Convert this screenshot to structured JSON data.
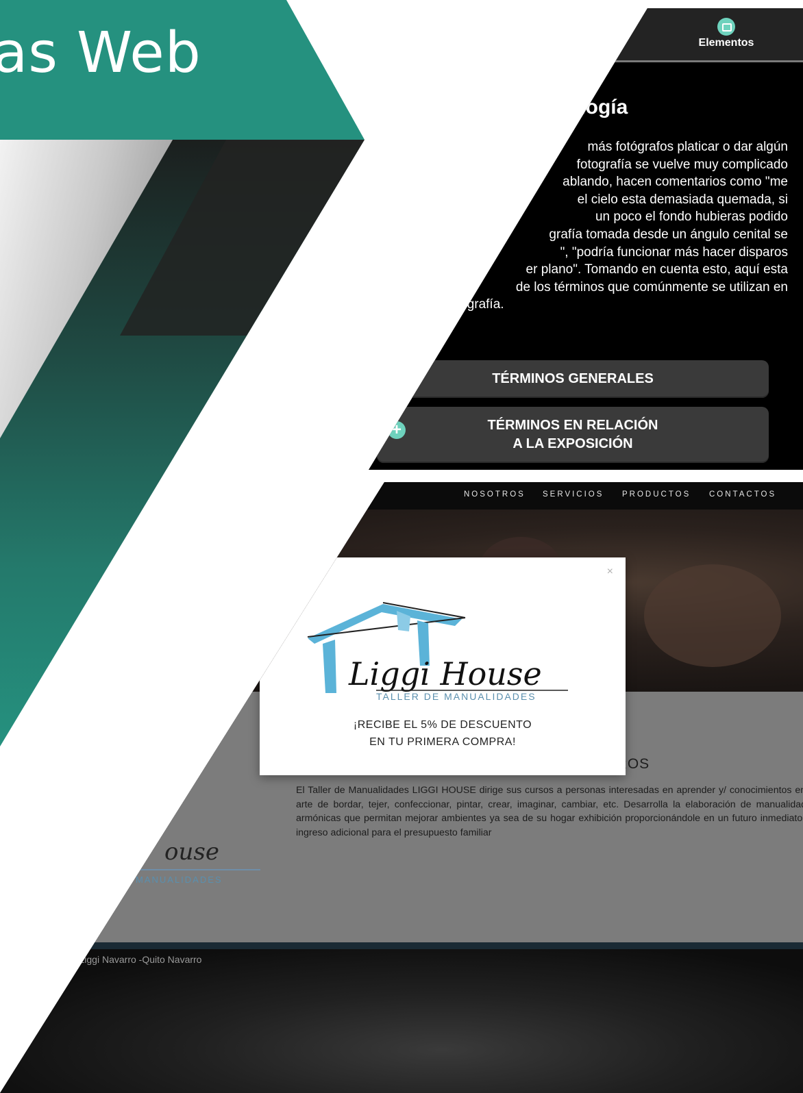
{
  "slide": {
    "title_fragment": "as Web",
    "colors": {
      "teal": "#25917f",
      "dark": "#1e1e1e",
      "white": "#ffffff"
    }
  },
  "photo_app": {
    "tab_label": "Elementos",
    "tab_icon": "camera-icon",
    "section_title_fragment": "ología",
    "body_lines": [
      "más fotógrafos platicar o dar algún",
      "fotografía se vuelve muy complicado",
      "ablando, hacen comentarios como \"me",
      "el cielo esta demasiada quemada, si",
      "un poco el fondo hubieras podido",
      "grafía tomada desde un ángulo cenital se",
      "\", \"podría funcionar más hacer disparos",
      "er plano\". Tomando en cuenta esto, aquí esta",
      "de los términos que comúnmente se utilizan en",
      "fotografía."
    ],
    "button_general": "TÉRMINOS GENERALES",
    "button_exposure_line1": "TÉRMINOS EN RELACIÓN",
    "button_exposure_line2": "A LA EXPOSICIÓN",
    "accent_color": "#6ed2bd"
  },
  "liggi_site": {
    "nav": [
      "NOSOTROS",
      "SERVICIOS",
      "PRODUCTOS",
      "CONTACTOS"
    ],
    "modal": {
      "close_symbol": "×",
      "logo_name": "Liggi House",
      "logo_tagline": "TALLER DE MANUALIDADES",
      "promo_line1": "¡RECIBE EL 5% DE DESCUENTO",
      "promo_line2": "EN TU PRIMERA COMPRA!"
    },
    "section_title": "NOSOTROS",
    "about_text": "El Taller de Manualidades LIGGI HOUSE dirige sus cursos a personas interesadas en aprender y/ conocimientos en el arte de bordar, tejer, confeccionar, pintar, crear, imaginar, cambiar, etc. Desarrolla la elaboración de manualidades armónicas que permitan mejorar ambientes ya sea de su hogar exhibición proporcionándole en un futuro inmediato un ingreso adicional para el presupuesto familiar",
    "logo_fragment": "ouse",
    "logo_fragment_sub": "MANUALIDADES",
    "credit": "prendedora Liggi Navarro -Quito Navarro"
  }
}
